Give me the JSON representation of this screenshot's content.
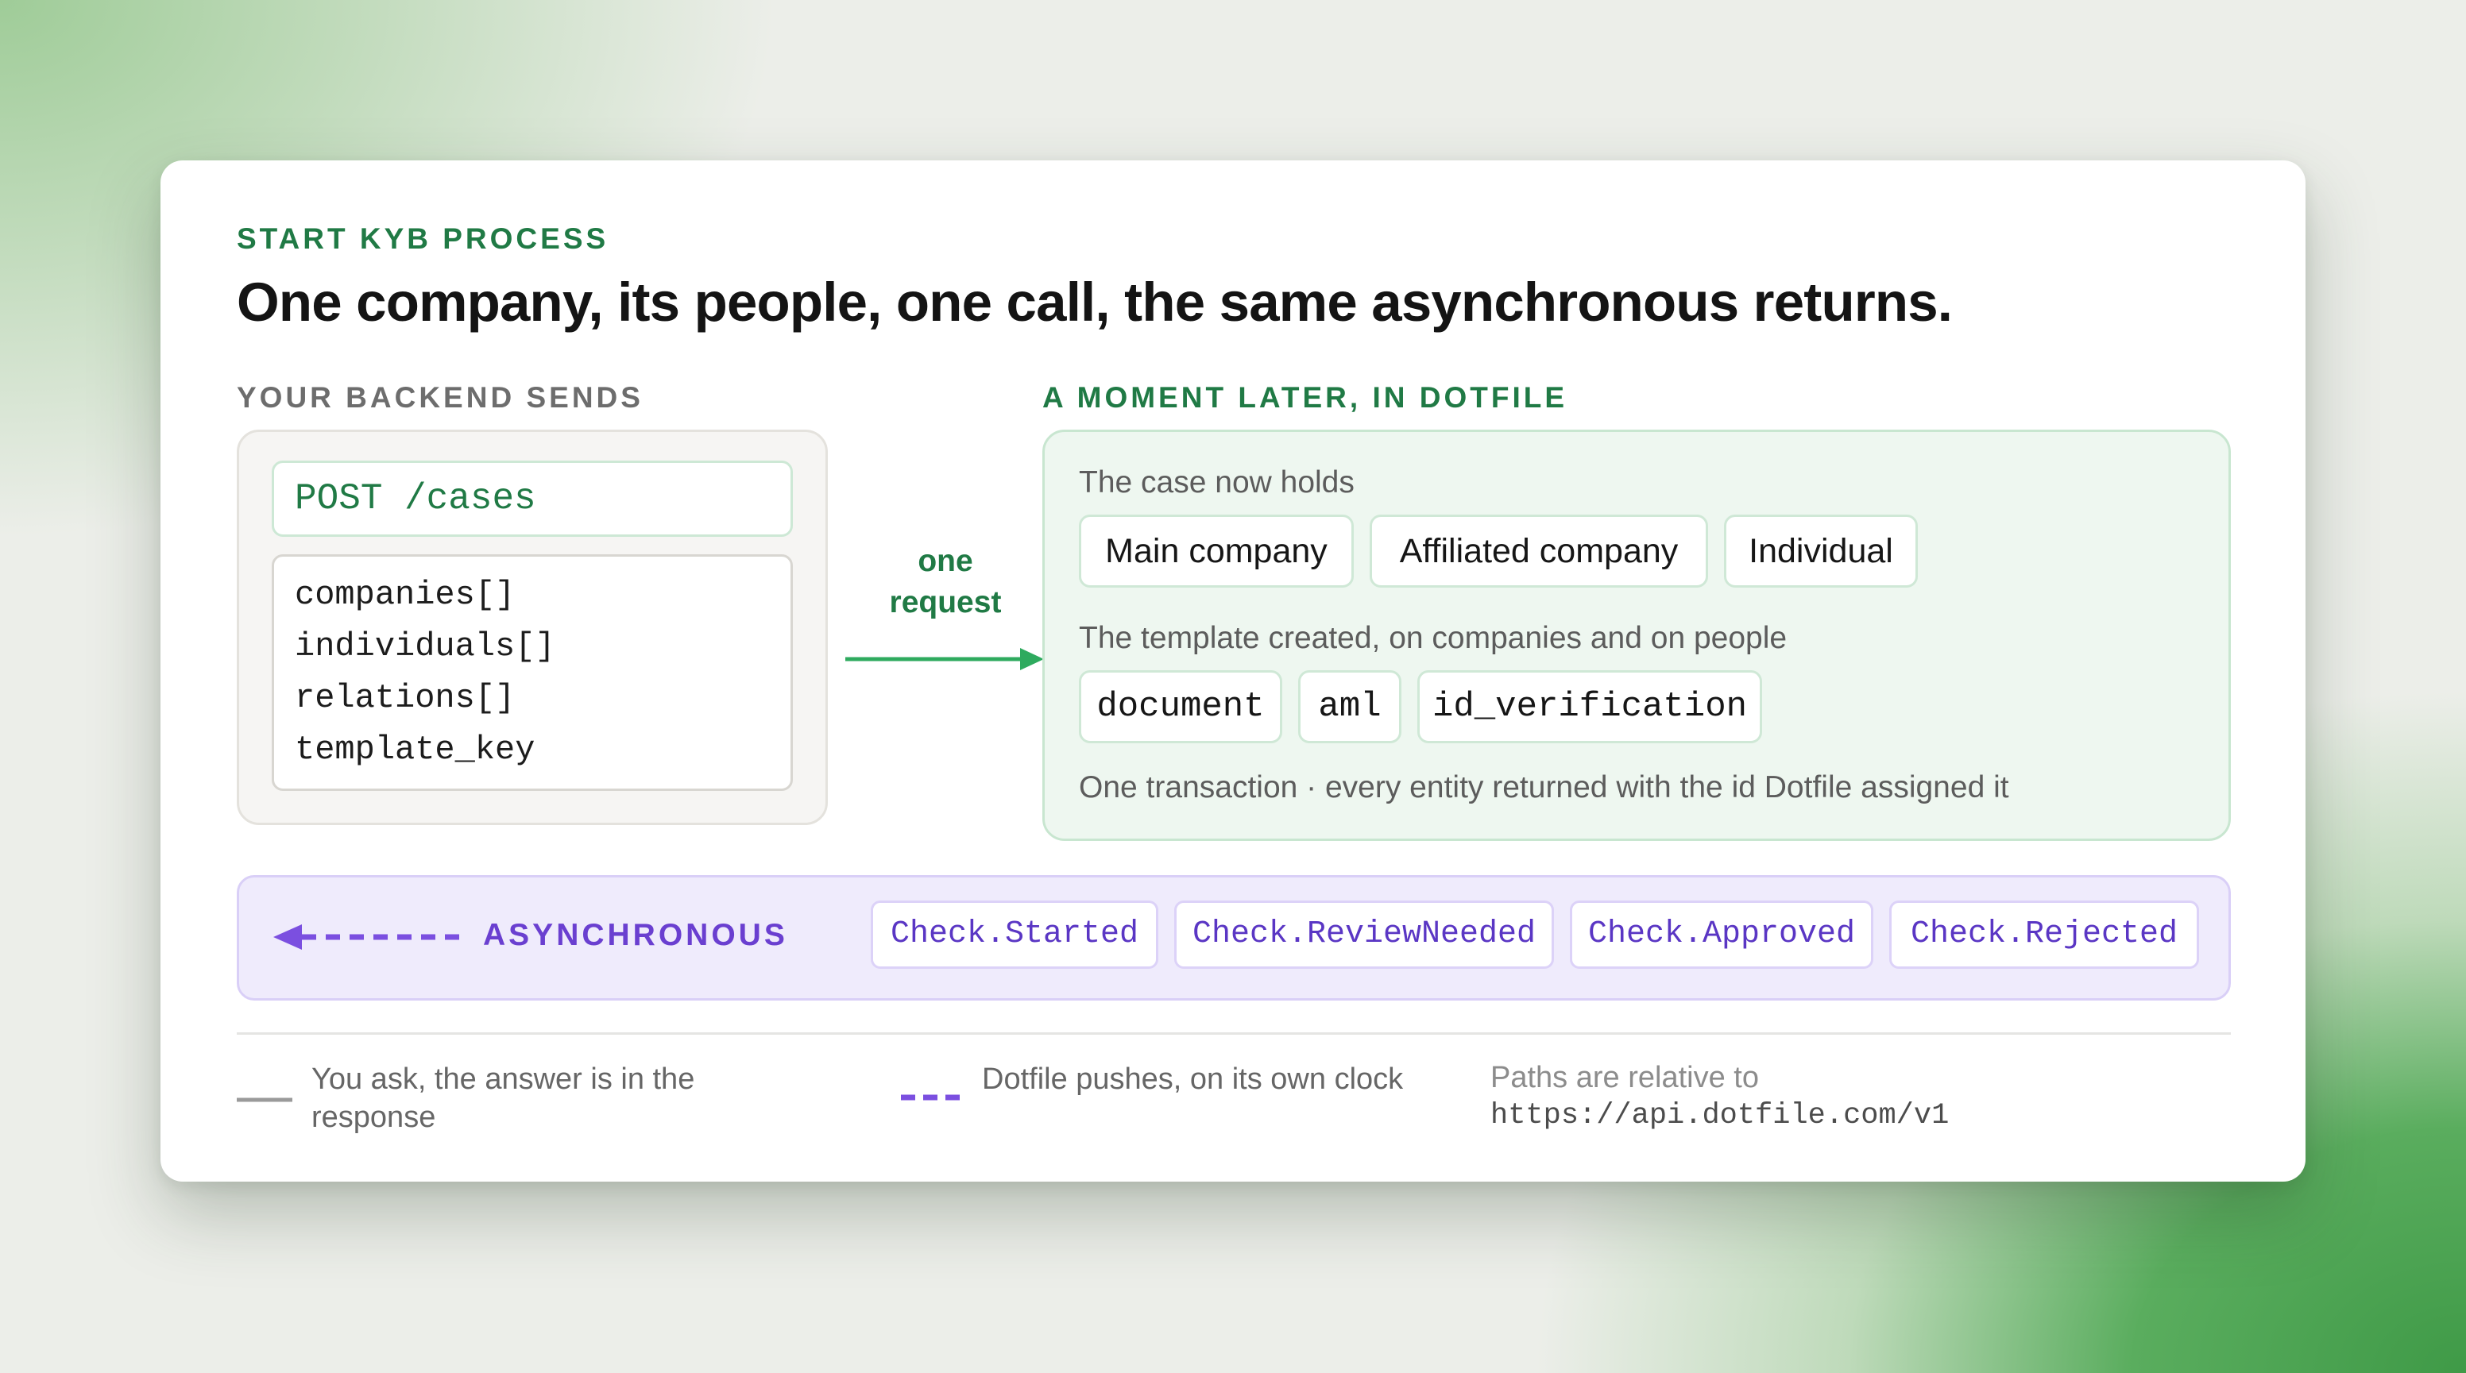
{
  "eyebrow": "START KYB PROCESS",
  "headline": "One company, its people, one call, the same asynchronous returns.",
  "left": {
    "heading": "YOUR BACKEND SENDS",
    "endpoint": "POST /cases",
    "fields": [
      "companies[]",
      "individuals[]",
      "relations[]",
      "template_key"
    ]
  },
  "flow": {
    "label_line1": "one",
    "label_line2": "request"
  },
  "right": {
    "heading": "A MOMENT LATER, IN DOTFILE",
    "holds_caption": "The case now holds",
    "entities": [
      "Main company",
      "Affiliated company",
      "Individual"
    ],
    "template_caption": "The template created, on companies and on people",
    "checks": [
      "document",
      "aml",
      "id_verification"
    ],
    "footnote": "One transaction · every entity returned with the id Dotfile assigned it"
  },
  "async": {
    "label": "ASYNCHRONOUS",
    "events": [
      "Check.Started",
      "Check.ReviewNeeded",
      "Check.Approved",
      "Check.Rejected"
    ]
  },
  "legend": {
    "sync_text": "You ask, the answer is in the response",
    "async_text": "Dotfile pushes, on its own clock",
    "paths_caption": "Paths are relative to",
    "base_url": "https://api.dotfile.com/v1"
  },
  "colors": {
    "green_accent": "#207a45",
    "arrow_green": "#2eaa5e",
    "purple_accent": "#7b4fe0",
    "async_text": "#6a3fd0",
    "legend_grey": "#9a9a9a"
  }
}
